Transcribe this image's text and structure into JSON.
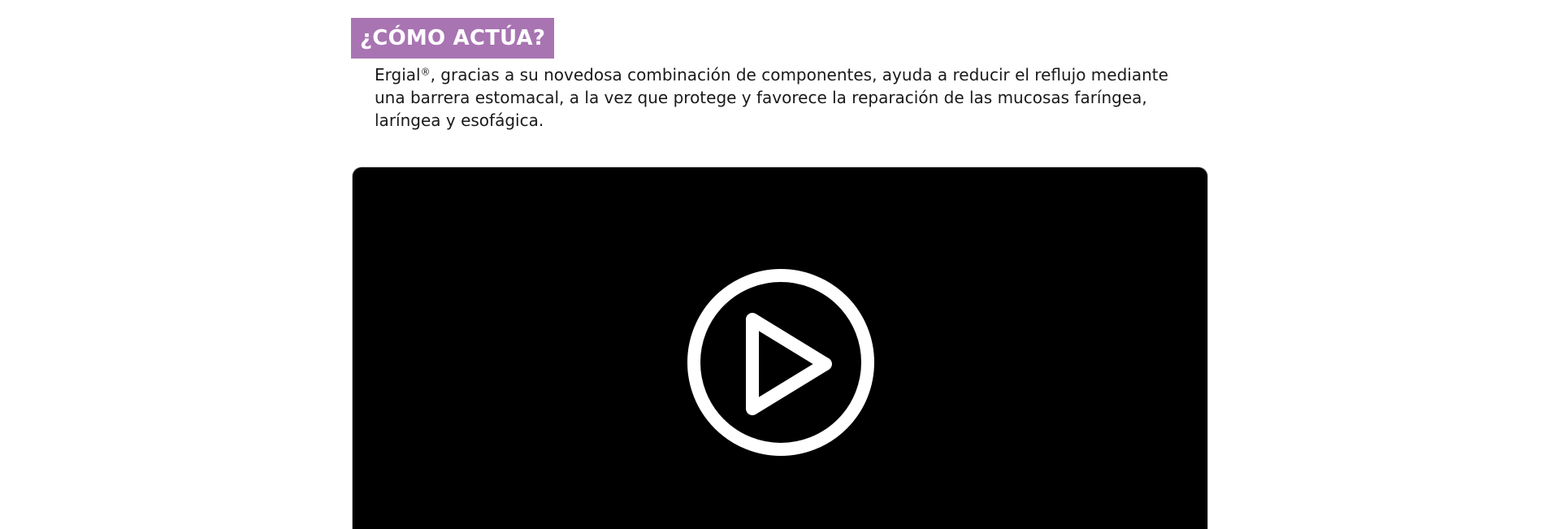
{
  "section": {
    "heading": "¿CÓMO ACTÚA?"
  },
  "description": {
    "brand": "Ergial",
    "registered_mark": "®",
    "text": ", gracias a su novedosa combinación de componentes, ayuda a reducir el reflujo mediante una barrera estomacal, a la vez que protege y favorece la reparación de las mucosas faríngea, laríngea y esofágica."
  },
  "video": {
    "play_icon": "play-circle-icon"
  },
  "colors": {
    "heading_background": "#a874b2",
    "heading_text": "#ffffff",
    "body_text": "#1a1a1a",
    "video_background": "#000000",
    "play_icon": "#ffffff"
  }
}
